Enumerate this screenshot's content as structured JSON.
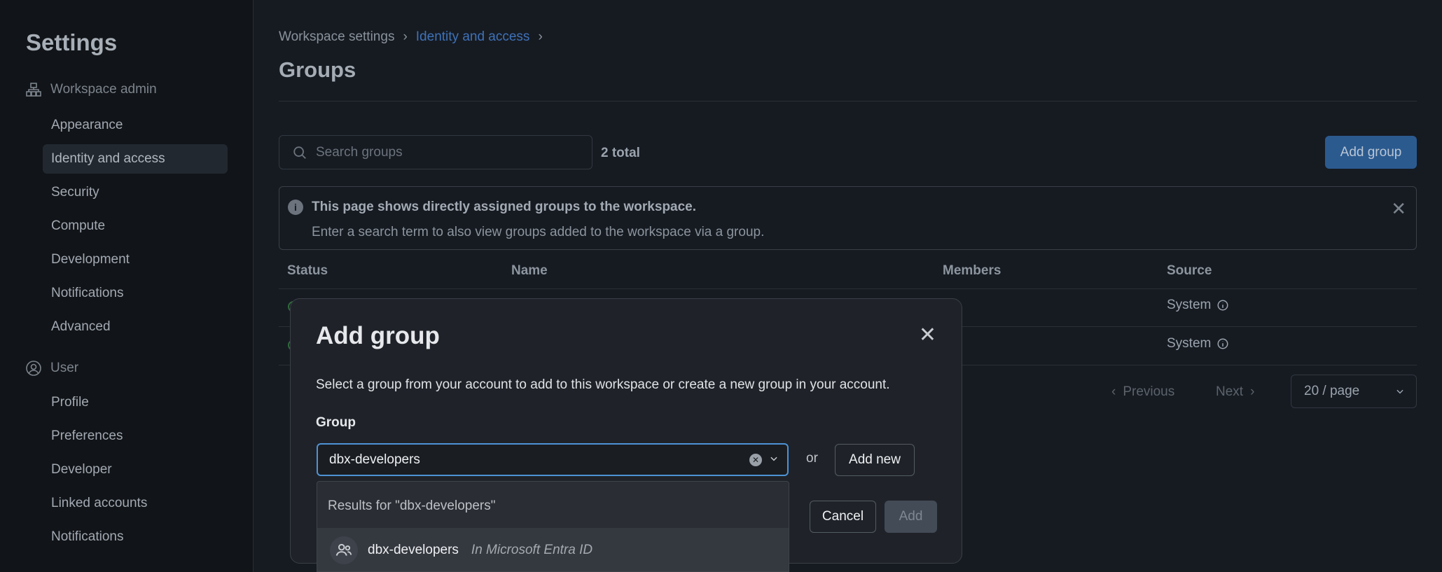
{
  "sidebar": {
    "title": "Settings",
    "workspace_admin": {
      "label": "Workspace admin",
      "items": [
        "Appearance",
        "Identity and access",
        "Security",
        "Compute",
        "Development",
        "Notifications",
        "Advanced"
      ]
    },
    "user": {
      "label": "User",
      "items": [
        "Profile",
        "Preferences",
        "Developer",
        "Linked accounts",
        "Notifications"
      ]
    }
  },
  "breadcrumb": {
    "root": "Workspace settings",
    "current": "Identity and access",
    "sep": "›"
  },
  "page": {
    "title": "Groups"
  },
  "search": {
    "placeholder": "Search groups"
  },
  "total": "2 total",
  "add_group_label": "Add group",
  "info": {
    "title": "This page shows directly assigned groups to the workspace.",
    "text": "Enter a search term to also view groups added to the workspace via a group.",
    "icon": "i"
  },
  "table": {
    "headers": {
      "status": "Status",
      "name": "Name",
      "members": "Members",
      "source": "Source"
    },
    "rows": [
      {
        "source": "System"
      },
      {
        "source": "System"
      }
    ]
  },
  "pagination": {
    "previous": "Previous",
    "next": "Next",
    "per_page": "20 / page"
  },
  "modal": {
    "title": "Add group",
    "description": "Select a group from your account to add to this workspace or create a new group in your account.",
    "group_label": "Group",
    "group_value": "dbx-developers",
    "or": "or",
    "add_new": "Add new",
    "cancel": "Cancel",
    "add": "Add"
  },
  "dropdown": {
    "header": "Results for \"dbx-developers\"",
    "options": [
      {
        "name": "dbx-developers",
        "source": "In Microsoft Entra ID"
      }
    ]
  },
  "colors": {
    "accent": "#4e93d6",
    "primary_button": "#2b5a8f",
    "link": "#3f72b8"
  }
}
